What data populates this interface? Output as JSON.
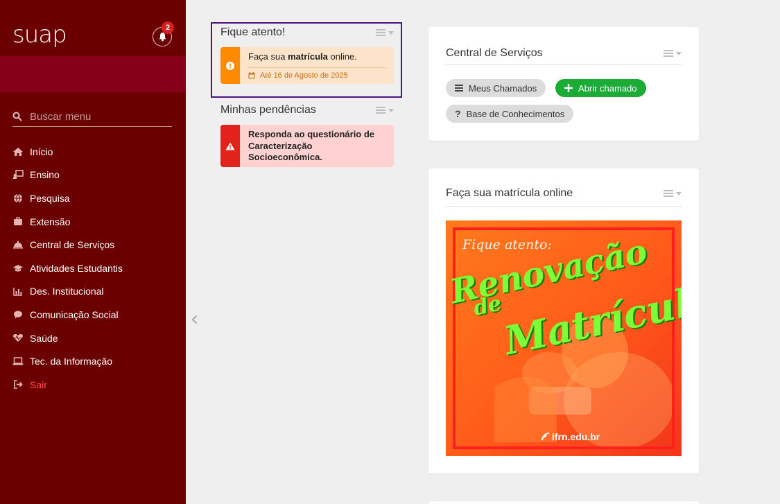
{
  "app": {
    "logo": "suap",
    "notifications_count": "2"
  },
  "search": {
    "placeholder": "Buscar menu"
  },
  "menu": [
    {
      "label": "Início",
      "icon": "home-icon"
    },
    {
      "label": "Ensino",
      "icon": "teacher-icon"
    },
    {
      "label": "Pesquisa",
      "icon": "globe-icon"
    },
    {
      "label": "Extensão",
      "icon": "briefcase-icon"
    },
    {
      "label": "Central de Serviços",
      "icon": "service-bell-icon"
    },
    {
      "label": "Atividades Estudantis",
      "icon": "graduation-cap-icon"
    },
    {
      "label": "Des. Institucional",
      "icon": "bar-chart-icon"
    },
    {
      "label": "Comunicação Social",
      "icon": "speech-bubble-icon"
    },
    {
      "label": "Saúde",
      "icon": "heartbeat-icon"
    },
    {
      "label": "Tec. da Informação",
      "icon": "laptop-icon"
    },
    {
      "label": "Sair",
      "icon": "sign-out-icon"
    }
  ],
  "fique_atento": {
    "title": "Fique atento!",
    "message_pre": "Faça sua ",
    "message_bold": "matrícula",
    "message_post": " online.",
    "date": "Até 16 de Agosto de 2025"
  },
  "pendencias": {
    "title": "Minhas pendências",
    "message": "Responda ao questionário de Caracterização Socioeconômica."
  },
  "central_servicos": {
    "title": "Central de Serviços",
    "buttons": {
      "meus_chamados": "Meus Chamados",
      "abrir_chamado": "Abrir chamado",
      "base_conhecimentos": "Base de Conhecimentos"
    }
  },
  "matricula": {
    "title": "Faça sua matrícula online",
    "poster": {
      "heading": "Fique atento:",
      "word1": "Renovação",
      "word2": "de",
      "word3": "Matrícula",
      "url": "ifrn.edu.br"
    }
  },
  "colors": {
    "sidebar": "#6b0000",
    "banner": "#86001a",
    "warning": "#ff8a00",
    "danger": "#e3221b",
    "success": "#1cab36",
    "highlight": "#4a1380"
  }
}
